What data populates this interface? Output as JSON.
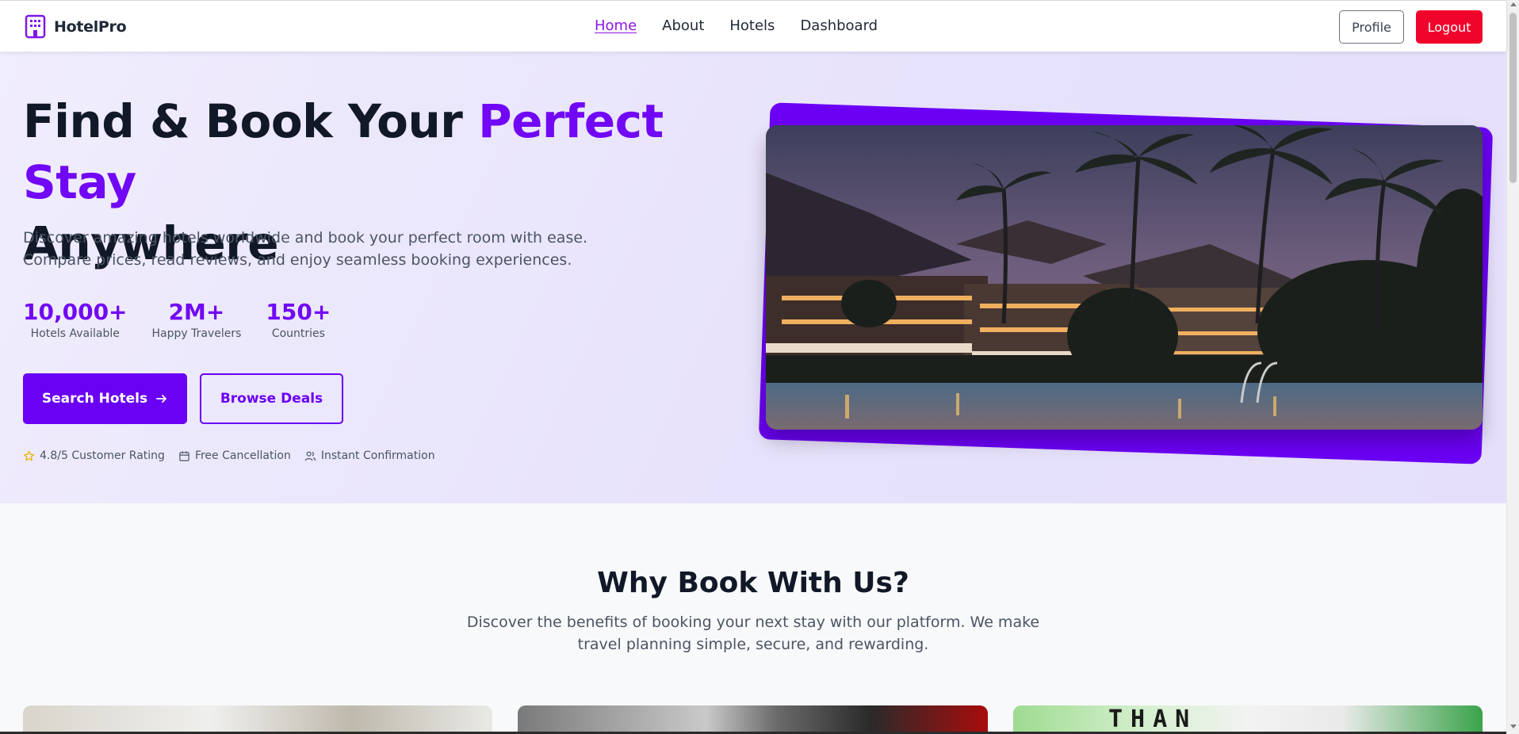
{
  "navbar": {
    "brand": "HotelPro",
    "links": [
      "Home",
      "About",
      "Hotels",
      "Dashboard"
    ],
    "active_link": "Home",
    "profile_label": "Profile",
    "logout_label": "Logout"
  },
  "hero": {
    "title_part1": "Find & Book Your ",
    "title_accent": "Perfect Stay",
    "title_part2": "Anywhere",
    "description": "Discover amazing hotels worldwide and book your perfect room with ease. Compare prices, read reviews, and enjoy seamless booking experiences.",
    "stats": [
      {
        "value": "10,000+",
        "label": "Hotels Available"
      },
      {
        "value": "2M+",
        "label": "Happy Travelers"
      },
      {
        "value": "150+",
        "label": "Countries"
      }
    ],
    "search_button": "Search Hotels",
    "deals_button": "Browse Deals",
    "features": [
      {
        "icon": "star-icon",
        "label": "4.8/5 Customer Rating"
      },
      {
        "icon": "calendar-icon",
        "label": "Free Cancellation"
      },
      {
        "icon": "users-icon",
        "label": "Instant Confirmation"
      }
    ]
  },
  "why": {
    "title": "Why Book With Us?",
    "description": "Discover the benefits of booking your next stay with our platform. We make travel planning simple, secure, and rewarding.",
    "card3_partial_text": "THAN"
  },
  "colors": {
    "accent": "#7108f5",
    "button_primary": "#6a00f4",
    "logout": "#f0042c",
    "nav_active": "#8b16e8"
  }
}
